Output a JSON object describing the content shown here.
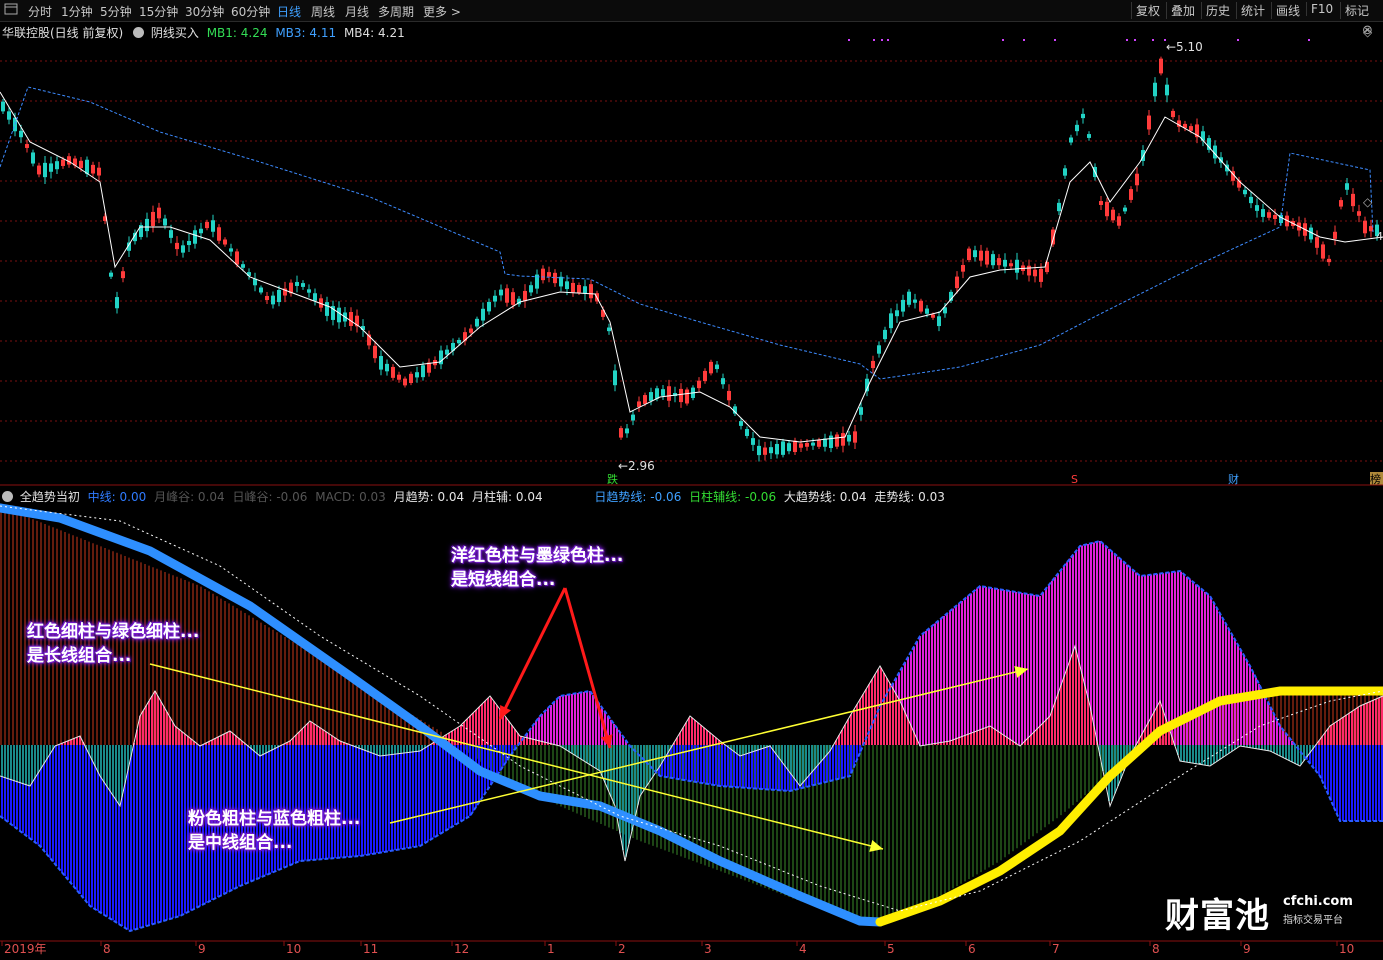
{
  "toolbar": {
    "period_tabs": [
      "分时",
      "1分钟",
      "5分钟",
      "15分钟",
      "30分钟",
      "60分钟",
      "日线",
      "周线",
      "月线",
      "多周期",
      "更多 >"
    ],
    "active_tab": "日线",
    "right_buttons": [
      "复权",
      "叠加",
      "历史",
      "统计",
      "画线",
      "F10",
      "标记"
    ]
  },
  "main_panel": {
    "stock_title": "华联控股(日线 前复权)",
    "indicator": "阴线买入",
    "mb1": "MB1: 4.24",
    "mb3": "MB3: 4.11",
    "mb4": "MB4: 4.21",
    "high_label": "5.10",
    "low_label": "2.96",
    "marker_die": "跌",
    "marker_s": "S",
    "marker_cai": "财",
    "marker_corner": "榜",
    "right_cut_value": "4",
    "colors": {
      "up": "#ff3b3b",
      "down": "#22d3c5",
      "ma": "#ffffff",
      "trend": "#3d8bff",
      "grid": "#7a1010"
    }
  },
  "sub_panel": {
    "indicator_name": "全趋势当初",
    "params": [
      {
        "text": "中线: 0.00",
        "color": "#2f7bff"
      },
      {
        "text": "月峰谷: 0.04",
        "color": "#555555"
      },
      {
        "text": "日峰谷: -0.06",
        "color": "#555555"
      },
      {
        "text": "MACD: 0.03",
        "color": "#555555"
      },
      {
        "text": "月趋势: 0.04",
        "color": "#e6e6e6"
      },
      {
        "text": "月柱辅: 0.04",
        "color": "#e6e6e6"
      },
      {
        "text": "日趋势线: -0.06",
        "color": "#3fa0ff"
      },
      {
        "text": "日柱辅线: -0.06",
        "color": "#33dd33"
      },
      {
        "text": "大趋势线: 0.04",
        "color": "#e6e6e6"
      },
      {
        "text": "走势线: 0.03",
        "color": "#e6e6e6"
      }
    ],
    "annotations": {
      "short": [
        "洋红色柱与墨绿色柱...",
        "是短线组合..."
      ],
      "long": [
        "红色细柱与绿色细柱...",
        "是长线组合..."
      ],
      "mid": [
        "粉色粗柱与蓝色粗柱...",
        "是中线组合..."
      ]
    }
  },
  "x_axis": {
    "labels": [
      "2019年",
      "8",
      "9",
      "10",
      "11",
      "12",
      "1",
      "2",
      "3",
      "4",
      "5",
      "6",
      "7",
      "8",
      "9",
      "10"
    ]
  },
  "watermark": {
    "brand": "财富池",
    "domain": "cfchi.com",
    "tagline": "指标交易平台"
  }
}
